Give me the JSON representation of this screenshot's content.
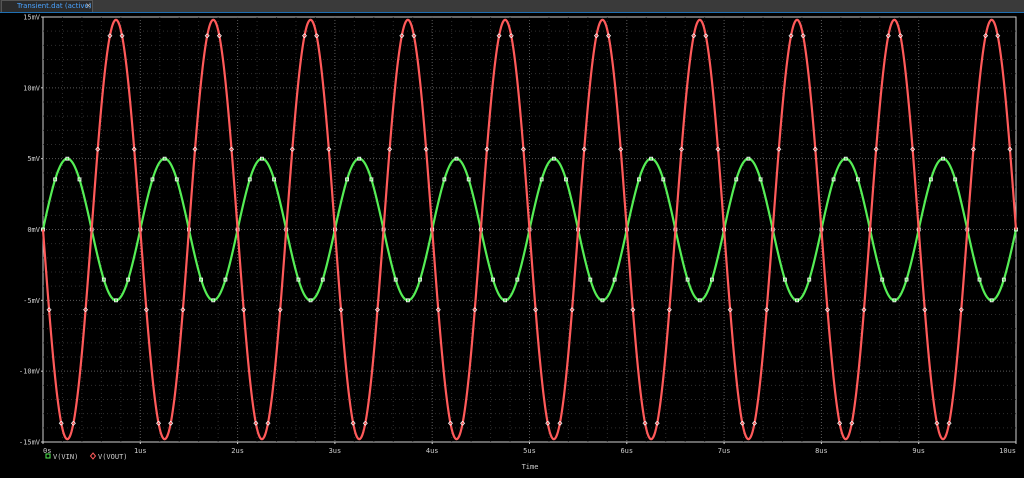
{
  "tab": {
    "title": "Transient.dat (active)",
    "close_glyph": "×"
  },
  "colors": {
    "background": "#000000",
    "grid": "#5a5a5a",
    "axis_text": "#cfcfcf",
    "tab_text": "#4aa3ff"
  },
  "chart_data": {
    "type": "line",
    "title": "",
    "xlabel": "Time",
    "ylabel": "",
    "x_unit": "us",
    "xlim": [
      0,
      10
    ],
    "ylim": [
      -15,
      15
    ],
    "x_ticks": [
      0,
      1,
      2,
      3,
      4,
      5,
      6,
      7,
      8,
      9,
      10
    ],
    "x_tick_labels": [
      "0s",
      "1us",
      "2us",
      "3us",
      "4us",
      "5us",
      "6us",
      "7us",
      "8us",
      "9us",
      "10us"
    ],
    "y_ticks": [
      15,
      10,
      5,
      0,
      -5,
      -10,
      -15
    ],
    "y_tick_labels": [
      "15mV",
      "10mV",
      "5mV",
      "0mV",
      "-5mV",
      "-10mV",
      "-15mV"
    ],
    "grid": true,
    "legend_position": "bottom-left",
    "series": [
      {
        "name": "V(VIN)",
        "color": "#55ee55",
        "marker": "square",
        "waveform": "sine",
        "amplitude": 5,
        "frequency_mhz": 1,
        "phase_deg": 0
      },
      {
        "name": "V(VOUT)",
        "color": "#ff5a5a",
        "marker": "diamond",
        "waveform": "sine",
        "amplitude": 14.8,
        "frequency_mhz": 1,
        "phase_deg": 180
      }
    ]
  }
}
